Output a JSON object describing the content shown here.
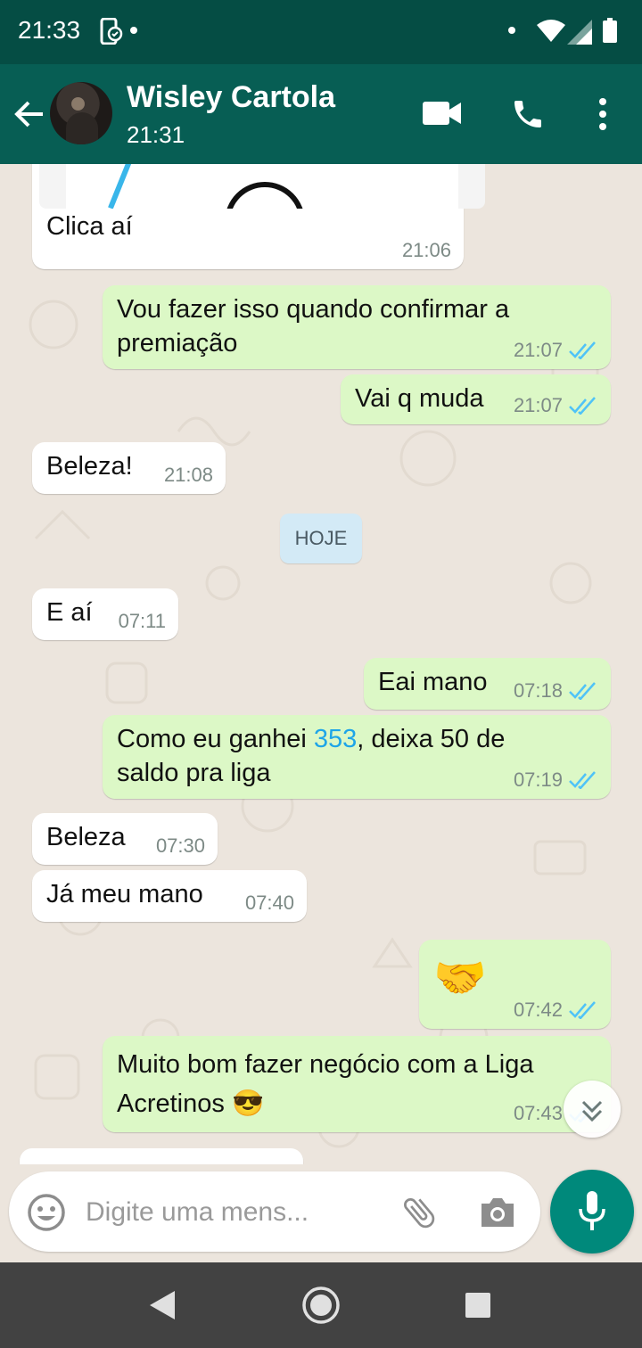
{
  "status_bar": {
    "time": "21:33"
  },
  "header": {
    "contact_name": "Wisley Cartola",
    "last_seen": "21:31"
  },
  "messages": [
    {
      "dir": "in",
      "text": "Clica aí",
      "time": "21:06",
      "has_preview": true
    },
    {
      "dir": "out",
      "text": "Vou fazer isso quando confirmar a premiação",
      "time": "21:07",
      "read": true
    },
    {
      "dir": "out",
      "text": "Vai q muda",
      "time": "21:07",
      "read": true
    },
    {
      "dir": "in",
      "text": "Beleza!",
      "time": "21:08"
    },
    {
      "dir": "in",
      "text": "E aí",
      "time": "07:11"
    },
    {
      "dir": "out",
      "text": "Eai mano",
      "time": "07:18",
      "read": true
    },
    {
      "dir": "out",
      "text_before": "Como eu ganhei ",
      "link_text": "353",
      "text_after": ", deixa 50 de saldo pra liga",
      "time": "07:19",
      "read": true
    },
    {
      "dir": "in",
      "text": "Beleza",
      "time": "07:30"
    },
    {
      "dir": "in",
      "text": "Já meu mano",
      "time": "07:40"
    },
    {
      "dir": "out",
      "text": "🤝",
      "time": "07:42",
      "read": true
    },
    {
      "dir": "out",
      "text": "Muito bom fazer negócio com a Liga Acretinos 😎",
      "time": "07:43",
      "read": true
    }
  ],
  "day_divider": "HOJE",
  "composer": {
    "placeholder": "Digite uma mens..."
  },
  "colors": {
    "header": "#075e54",
    "status_bar": "#054d44",
    "outgoing": "#dcf8c6",
    "incoming": "#ffffff",
    "accent": "#00897b",
    "read_ticks": "#4fc3f7"
  },
  "icons": [
    "back-arrow-icon",
    "video-call-icon",
    "phone-icon",
    "more-vert-icon",
    "emoji-icon",
    "attach-icon",
    "camera-icon",
    "mic-icon",
    "chevron-double-down-icon"
  ]
}
